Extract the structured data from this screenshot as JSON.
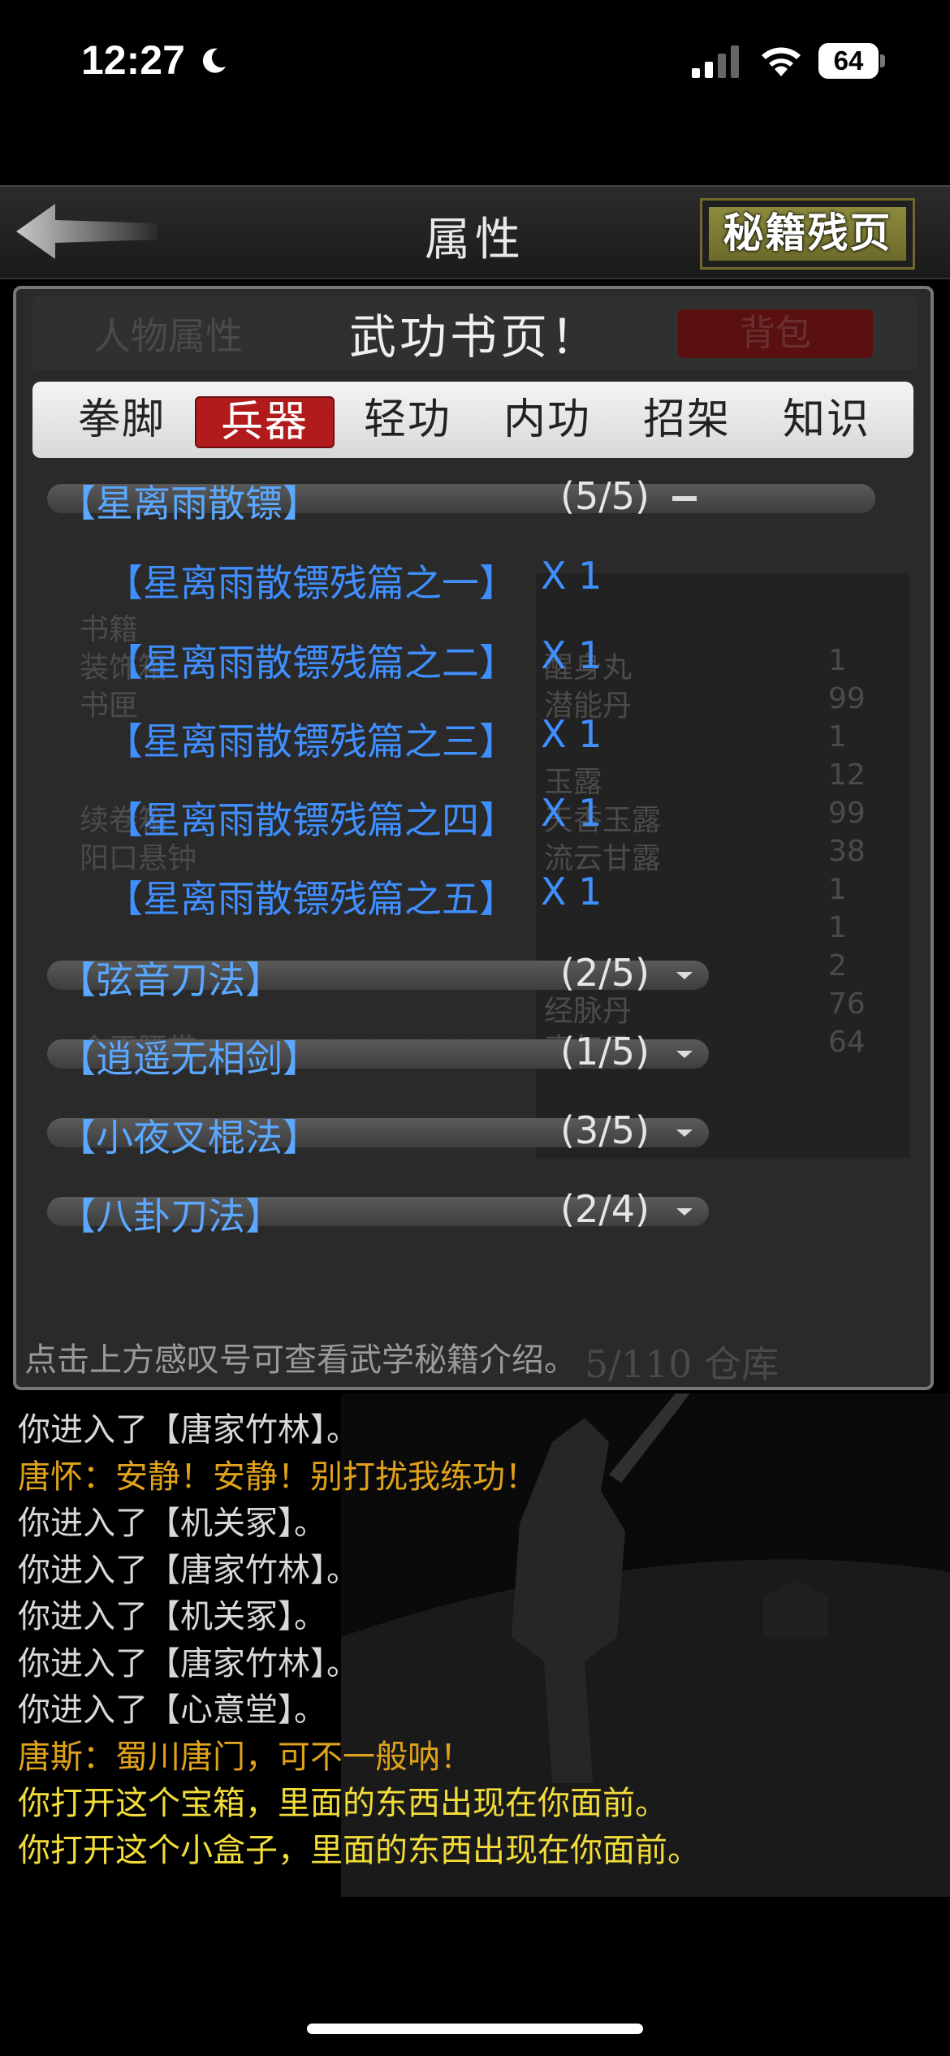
{
  "status": {
    "time": "12:27",
    "battery": "64"
  },
  "header": {
    "title": "属性",
    "secret_button": "秘籍残页"
  },
  "panel": {
    "title": "武功书页！",
    "background_tabs": {
      "left": "人物属性",
      "right": "背包"
    },
    "background_rows": [
      {
        "name": "书籍",
        "item": "",
        "count": ""
      },
      {
        "name": "装饰箱",
        "item": "醒身丸",
        "count": "1"
      },
      {
        "name": "书匣",
        "item": "潜能丹",
        "count": "99"
      },
      {
        "name": "",
        "item": "",
        "count": "1"
      },
      {
        "name": "",
        "item": "玉露",
        "count": "12"
      },
      {
        "name": "续卷箱",
        "item": "天香玉露",
        "count": "99"
      },
      {
        "name": "阳口悬钟",
        "item": "流云甘露",
        "count": "38"
      },
      {
        "name": "",
        "item": "",
        "count": "1"
      },
      {
        "name": "",
        "item": "",
        "count": "1"
      },
      {
        "name": "",
        "item": "",
        "count": "2"
      },
      {
        "name": "",
        "item": "经脉丹",
        "count": "76"
      },
      {
        "name": "金玉腰带",
        "item": "真气丹",
        "count": "64"
      }
    ],
    "background_footer": "5/110 仓库",
    "tabs": [
      "拳脚",
      "兵器",
      "轻功",
      "内功",
      "招架",
      "知识"
    ],
    "active_tab": "兵器",
    "groups": [
      {
        "name": "【星离雨散镖】",
        "count": "(5/5)",
        "expanded": true,
        "items": [
          {
            "name": "【星离雨散镖残篇之一】",
            "qty": "X 1"
          },
          {
            "name": "【星离雨散镖残篇之二】",
            "qty": "X 1"
          },
          {
            "name": "【星离雨散镖残篇之三】",
            "qty": "X 1"
          },
          {
            "name": "【星离雨散镖残篇之四】",
            "qty": "X 1"
          },
          {
            "name": "【星离雨散镖残篇之五】",
            "qty": "X 1"
          }
        ]
      },
      {
        "name": "【弦音刀法】",
        "count": "(2/5)",
        "expanded": false
      },
      {
        "name": "【逍遥无相剑】",
        "count": "(1/5)",
        "expanded": false
      },
      {
        "name": "【小夜叉棍法】",
        "count": "(3/5)",
        "expanded": false
      },
      {
        "name": "【八卦刀法】",
        "count": "(2/4)",
        "expanded": false
      }
    ],
    "hint": "点击上方感叹号可查看武学秘籍介绍。"
  },
  "log": [
    {
      "text": "你进入了【唐家竹林】。",
      "color": "white"
    },
    {
      "text": "唐怀：安静！安静！别打扰我练功！",
      "color": "gold"
    },
    {
      "text": "你进入了【机关冢】。",
      "color": "white"
    },
    {
      "text": "你进入了【唐家竹林】。",
      "color": "white"
    },
    {
      "text": "你进入了【机关冢】。",
      "color": "white"
    },
    {
      "text": "你进入了【唐家竹林】。",
      "color": "white"
    },
    {
      "text": "你进入了【心意堂】。",
      "color": "white"
    },
    {
      "text": "唐斯：蜀川唐门，可不一般呐！",
      "color": "gold"
    },
    {
      "text": "你打开这个宝箱，里面的东西出现在你面前。",
      "color": "yellow"
    },
    {
      "text": "你打开这个小盒子，里面的东西出现在你面前。",
      "color": "yellow"
    }
  ],
  "colors": {
    "accent_red": "#b21b1b",
    "link_blue": "#3f8fff",
    "gold": "#e0a21a",
    "yellow": "#f2dc3a"
  }
}
